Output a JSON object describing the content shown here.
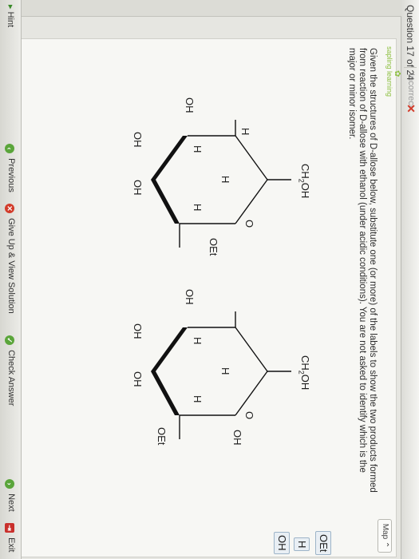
{
  "header": {
    "question_label": "Question 17 of 24",
    "status": "Incorrect",
    "status_mark": "✕"
  },
  "brand": {
    "name": "sapling learning"
  },
  "map": {
    "label": "Map"
  },
  "prompt": "Given the structures of D-allose below, substitute one (or more) of the labels to show the two products formed from reaction of D-allose with ethanol (under acidic conditions). You are not asked to identify which is the major or minor isomer.",
  "structures": {
    "left": {
      "ch2oh": "CH2OH",
      "ring_o": "O",
      "anomeric": "OEt",
      "h_top": "H",
      "h_mid1": "H",
      "h_mid2": "H",
      "h_bottom": "H",
      "oh_left": "OH",
      "oh_b1": "OH",
      "oh_b2": "OH"
    },
    "right": {
      "ch2oh": "CH2OH",
      "ring_o": "O",
      "anomeric": "OH",
      "h_top": "H",
      "h_mid1": "H",
      "h_mid2": "H",
      "anomeric_down": "OEt",
      "oh_left": "OH",
      "oh_b1": "OH",
      "oh_b2": "OH"
    }
  },
  "label_options": [
    "OEt",
    "H",
    "OH"
  ],
  "bottom": {
    "hint": "Hint",
    "previous": "Previous",
    "give_up": "Give Up & View Solution",
    "check": "Check Answer",
    "next": "Next",
    "exit": "Exit"
  }
}
